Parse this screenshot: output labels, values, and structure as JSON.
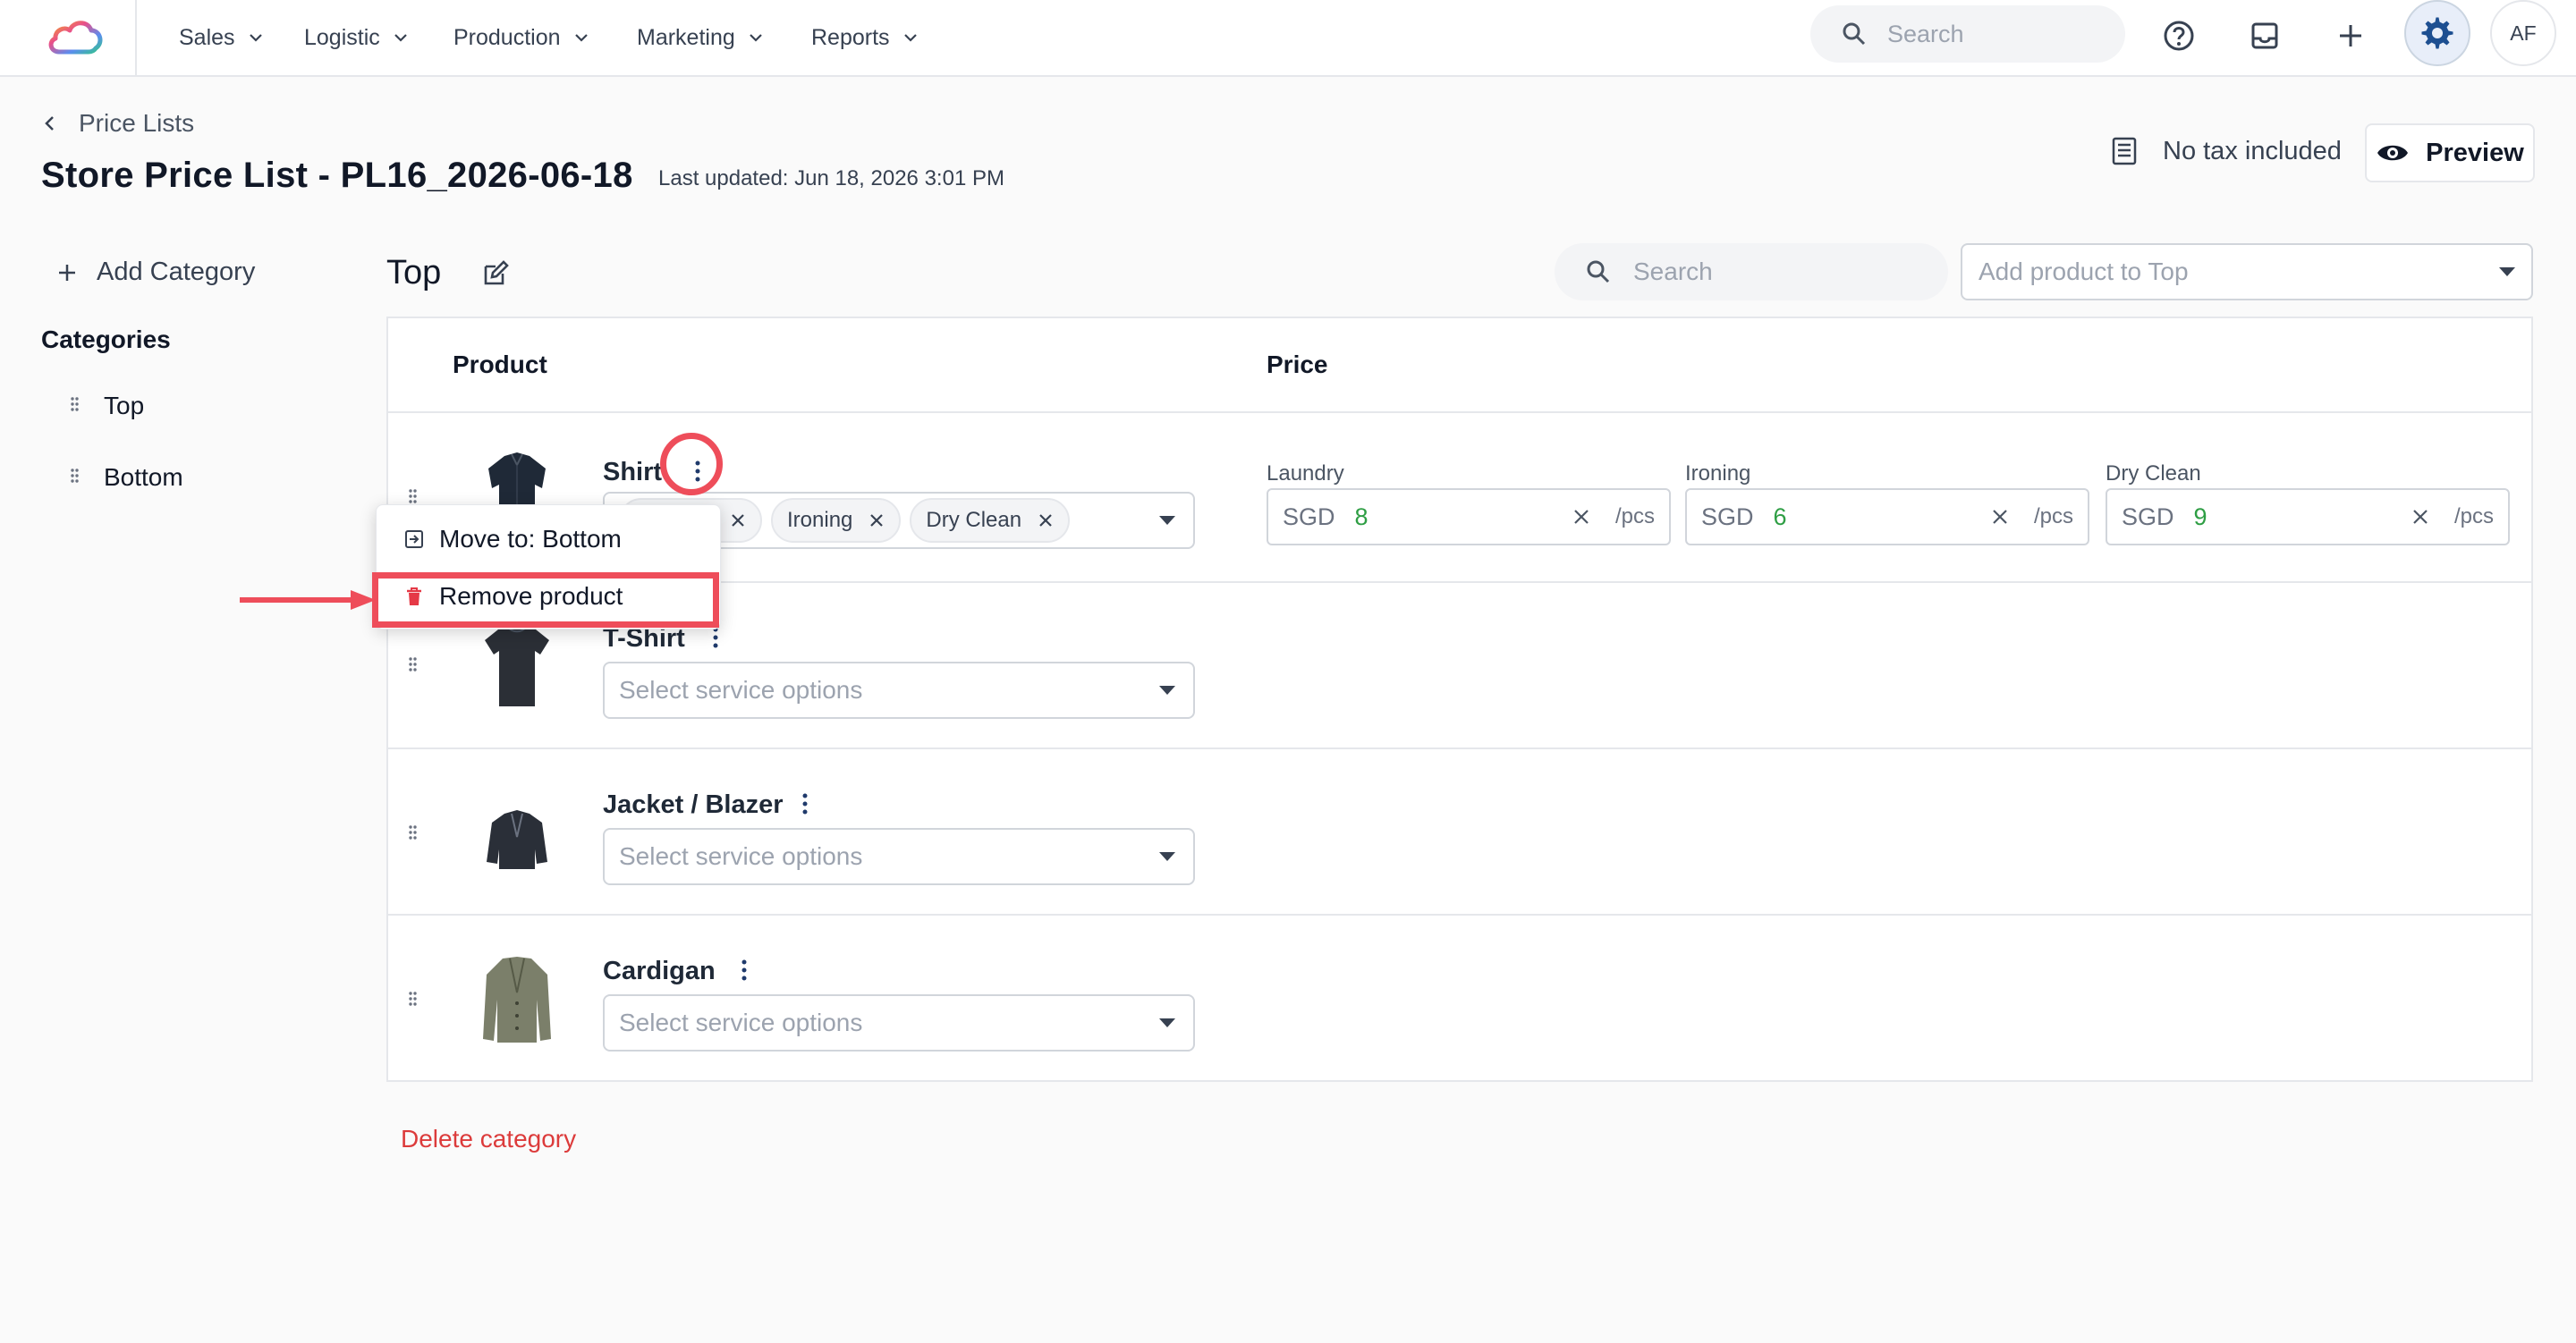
{
  "nav": {
    "items": [
      {
        "label": "Sales"
      },
      {
        "label": "Logistic"
      },
      {
        "label": "Production"
      },
      {
        "label": "Marketing"
      },
      {
        "label": "Reports"
      }
    ],
    "search_placeholder": "Search",
    "avatar_initials": "AF",
    "icons": [
      "help-icon",
      "inbox-icon",
      "plus-icon",
      "gear-icon"
    ]
  },
  "header": {
    "breadcrumb": "Price Lists",
    "title": "Store Price List - PL16_2026-06-18",
    "last_updated": "Last updated: Jun 18, 2026 3:01 PM",
    "tax_label": "No tax included",
    "preview_label": "Preview"
  },
  "sidebar": {
    "add_category_label": "Add Category",
    "categories_heading": "Categories",
    "categories": [
      {
        "label": "Top"
      },
      {
        "label": "Bottom"
      }
    ]
  },
  "category": {
    "title": "Top",
    "search_placeholder": "Search",
    "add_product_placeholder": "Add product to Top",
    "delete_label": "Delete category"
  },
  "table": {
    "columns": [
      "Product",
      "Price"
    ],
    "rows": [
      {
        "name": "Shirt",
        "services": [
          "Ironing",
          "Dry Clean"
        ],
        "prices": [
          {
            "label": "Laundry",
            "currency": "SGD",
            "value": "8",
            "unit": "/pcs"
          },
          {
            "label": "Ironing",
            "currency": "SGD",
            "value": "6",
            "unit": "/pcs"
          },
          {
            "label": "Dry Clean",
            "currency": "SGD",
            "value": "9",
            "unit": "/pcs"
          }
        ]
      },
      {
        "name": "T-Shirt",
        "placeholder": "Select service options"
      },
      {
        "name": "Jacket / Blazer",
        "placeholder": "Select service options"
      },
      {
        "name": "Cardigan",
        "placeholder": "Select service options"
      }
    ]
  },
  "context_menu": {
    "items": [
      {
        "label": "Move to: Bottom"
      },
      {
        "label": "Remove product"
      }
    ]
  },
  "colors": {
    "accent_red": "#ee4d5a",
    "price_green": "#2e9e44",
    "delete_red": "#dc3b3b"
  }
}
